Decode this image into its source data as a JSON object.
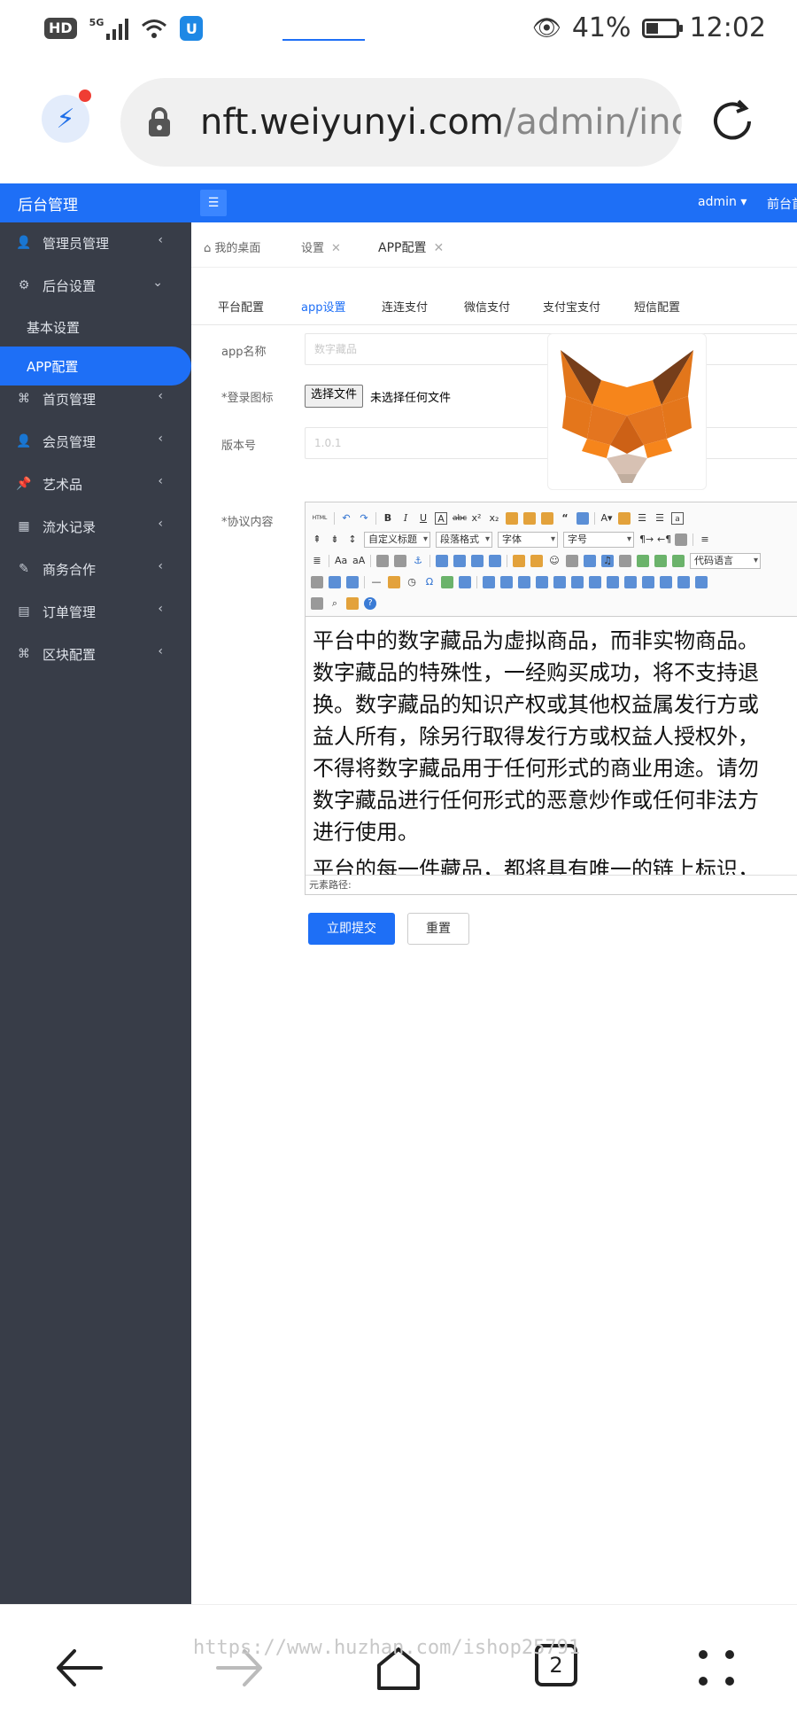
{
  "status_bar": {
    "hd": "HD",
    "network": "5G",
    "battery_percent": "41%",
    "battery_level": 0.41,
    "time": "12:02"
  },
  "browser": {
    "url_host": "nft.weiyunyi.com",
    "url_path": "/admin/inde"
  },
  "header": {
    "brand": "后台管理",
    "user": "admin",
    "front_link": "前台首"
  },
  "sidebar": {
    "items": [
      {
        "label": "管理员管理",
        "icon": "user-icon"
      },
      {
        "label": "后台设置",
        "icon": "gear-icon"
      },
      {
        "label": "首页管理",
        "icon": "grid-icon"
      },
      {
        "label": "会员管理",
        "icon": "user-icon"
      },
      {
        "label": "艺术品",
        "icon": "pin-icon"
      },
      {
        "label": "流水记录",
        "icon": "grid-icon"
      },
      {
        "label": "商务合作",
        "icon": "edit-icon"
      },
      {
        "label": "订单管理",
        "icon": "order-icon"
      },
      {
        "label": "区块配置",
        "icon": "grid-icon"
      }
    ],
    "sub_items": [
      {
        "label": "基本设置"
      },
      {
        "label": "APP配置"
      }
    ]
  },
  "page_tabs": [
    {
      "label": "我的桌面"
    },
    {
      "label": "设置"
    },
    {
      "label": "APP配置"
    }
  ],
  "sub_tabs": [
    {
      "label": "平台配置"
    },
    {
      "label": "app设置"
    },
    {
      "label": "连连支付"
    },
    {
      "label": "微信支付"
    },
    {
      "label": "支付宝支付"
    },
    {
      "label": "短信配置"
    }
  ],
  "form": {
    "app_name_label": "app名称",
    "app_name_placeholder": "数字藏品",
    "login_icon_label": "*登录图标",
    "file_button": "选择文件",
    "file_status": "未选择任何文件",
    "version_label": "版本号",
    "version_placeholder": "1.0.1",
    "agreement_label": "*协议内容"
  },
  "editor": {
    "toolbar": {
      "html": "HTML",
      "custom_title": "自定义标题",
      "paragraph": "段落格式",
      "font": "字体",
      "font_size": "字号",
      "code_lang": "代码语言"
    },
    "lines": [
      "平台中的数字藏品为虚拟商品，而非实物商品。",
      "数字藏品的特殊性，一经购买成功，将不支持退",
      "换。数字藏品的知识产权或其他权益属发行方或",
      "益人所有，除另行取得发行方或权益人授权外，",
      "不得将数字藏品用于任何形式的商业用途。请勿",
      "数字藏品进行任何形式的恶意炒作或任何非法方",
      "进行使用。"
    ],
    "line2": "平台的每一件藏品，都将具有唯一的链上标识，",
    "path_label": "元素路径:"
  },
  "buttons": {
    "submit": "立即提交",
    "reset": "重置"
  },
  "bottom_nav": {
    "watermark": "https://www.huzhan.com/ishop25791",
    "tabs_count": "2"
  }
}
